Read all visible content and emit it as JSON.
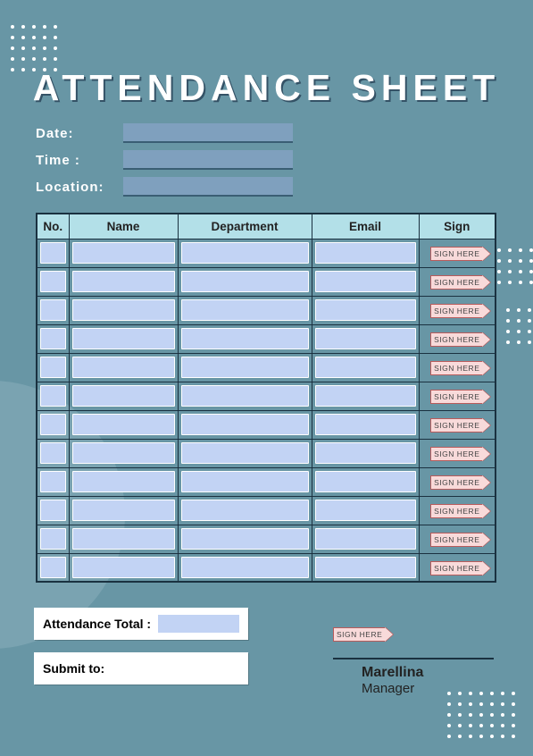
{
  "title": "ATTENDANCE SHEET",
  "meta": {
    "date_label": "Date:",
    "time_label": "Time :",
    "location_label": "Location:"
  },
  "table": {
    "headers": {
      "no": "No.",
      "name": "Name",
      "dept": "Department",
      "email": "Email",
      "sign": "Sign"
    },
    "sign_here": "SIGN HERE",
    "row_count": 12
  },
  "totals": {
    "attendance_total_label": "Attendance Total :",
    "submit_to_label": "Submit to:"
  },
  "signature": {
    "sign_here": "SIGN HERE",
    "name": "Marellina",
    "role": "Manager"
  }
}
